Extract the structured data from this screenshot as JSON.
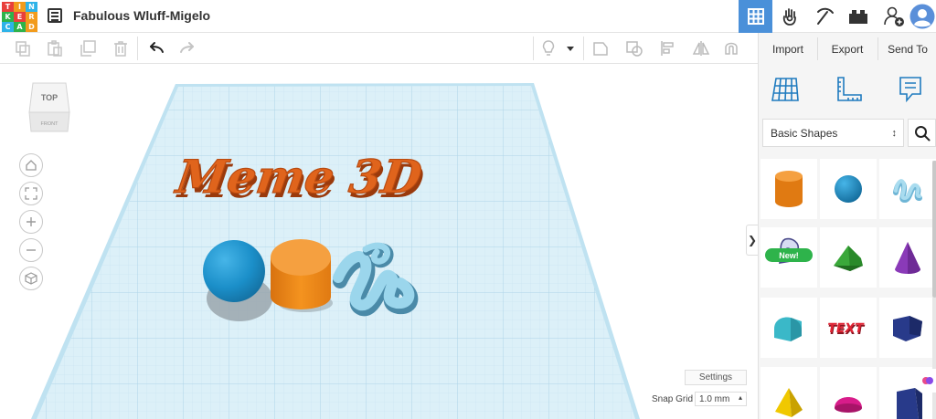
{
  "app": {
    "logo_letters": [
      "T",
      "I",
      "N",
      "K",
      "E",
      "R",
      "C",
      "A",
      "D"
    ],
    "logo_colors": [
      "#e8403c",
      "#f29b1c",
      "#2eb3e8",
      "#2eb34b",
      "#e8403c",
      "#f29b1c",
      "#2eb3e8",
      "#2eb34b",
      "#f29b1c"
    ],
    "design_title": "Fabulous Wluff-Migelo"
  },
  "header": {
    "buttons": [
      {
        "name": "3d-design-view-button",
        "icon": "grid-icon",
        "active": true
      },
      {
        "name": "sim-lab-button",
        "icon": "hand-icon",
        "active": false
      },
      {
        "name": "codeblocks-button",
        "icon": "pickaxe-icon",
        "active": false
      },
      {
        "name": "bricks-button",
        "icon": "bricks-icon",
        "active": false
      },
      {
        "name": "invite-user-button",
        "icon": "add-user-icon",
        "active": false
      },
      {
        "name": "profile-avatar",
        "icon": "avatar-icon",
        "active": false
      }
    ],
    "accent_color": "#4a90d9"
  },
  "toolbar": {
    "tools": [
      "copy-icon",
      "paste-icon",
      "duplicate-icon",
      "delete-icon",
      "undo-icon",
      "redo-icon",
      "lightbulb-icon",
      "dropdown-icon",
      "group-icon",
      "ungroup-icon",
      "align-icon",
      "mirror-icon",
      "magnet-icon"
    ]
  },
  "viewport": {
    "viewcube_top": "TOP",
    "viewcube_front": "FRONT",
    "nav_buttons": [
      "home-view",
      "fit-view",
      "zoom-in",
      "zoom-out",
      "perspective-toggle"
    ],
    "scene_text": "Meme 3D",
    "settings_label": "Settings",
    "snap_grid_label": "Snap Grid",
    "snap_grid_value": "1.0 mm",
    "object_colors": {
      "text": "#e0641c",
      "sphere": "#1b8fc9",
      "cylinder": "#f08a1c",
      "scribble": "#8fd0e8"
    },
    "workplane_color": "#d8edf6"
  },
  "panel": {
    "import_label": "Import",
    "export_label": "Export",
    "send_to_label": "Send To",
    "tools": [
      "workplane-icon",
      "ruler-icon",
      "notes-icon"
    ],
    "shapes_category": "Basic Shapes",
    "new_badge": "New!",
    "shapes": [
      {
        "name": "box-cylinder",
        "color": "#f08a1c"
      },
      {
        "name": "sphere",
        "color": "#1b8fc9"
      },
      {
        "name": "scribble",
        "color": "#8fd0e8"
      },
      {
        "name": "shape-generator",
        "color": "#6a7ac9"
      },
      {
        "name": "roof",
        "color": "#3aa83a"
      },
      {
        "name": "cone",
        "color": "#8a3ab8"
      },
      {
        "name": "round-roof",
        "color": "#3ab8c8"
      },
      {
        "name": "text",
        "color": "#d92030"
      },
      {
        "name": "polygon",
        "color": "#283a8a"
      },
      {
        "name": "pyramid",
        "color": "#f0c800"
      },
      {
        "name": "half-sphere",
        "color": "#d81c8a"
      },
      {
        "name": "wedge",
        "color": "#283a8a"
      }
    ]
  }
}
